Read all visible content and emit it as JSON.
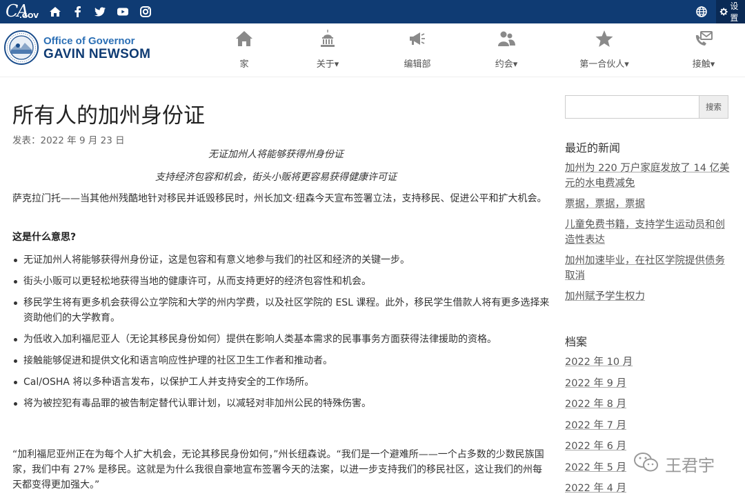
{
  "topbar": {
    "logo_text": "CA",
    "logo_sub": ".GOV",
    "social_icons": [
      "home-icon",
      "facebook-icon",
      "twitter-icon",
      "youtube-icon",
      "instagram-icon"
    ],
    "globe_icon": "globe-icon",
    "settings_label": "设置"
  },
  "header": {
    "brand_line1": "Office of Governor",
    "brand_line2": "GAVIN NEWSOM",
    "nav": [
      {
        "label": "家",
        "icon": "home-icon"
      },
      {
        "label": "关于▾",
        "icon": "capitol-icon"
      },
      {
        "label": "编辑部",
        "icon": "megaphone-icon"
      },
      {
        "label": "约会▾",
        "icon": "people-icon"
      },
      {
        "label": "第一合伙人▾",
        "icon": "star-icon"
      },
      {
        "label": "接触▾",
        "icon": "contact-icon"
      }
    ]
  },
  "article": {
    "title": "所有人的加州身份证",
    "posted": "发表：2022 年 9 月 23 日",
    "sub1": "无证加州人将能够获得州身份证",
    "sub2": "支持经济包容和机会，街头小贩将更容易获得健康许可证",
    "intro": "萨克拉门托——当其他州残酷地针对移民并诋毁移民时，州长加文·纽森今天宣布签署立法，支持移民、促进公平和扩大机会。",
    "heading": "这是什么意思?",
    "bullets": [
      "无证加州人将能够获得州身份证，这是包容和有意义地参与我们的社区和经济的关键一步。",
      "街头小贩可以更轻松地获得当地的健康许可，从而支持更好的经济包容性和机会。",
      "移民学生将有更多机会获得公立学院和大学的州内学费，以及社区学院的 ESL 课程。此外，移民学生借款人将有更多选择来资助他们的大学教育。",
      "为低收入加利福尼亚人（无论其移民身份如何）提供在影响人类基本需求的民事事务方面获得法律援助的资格。",
      "接触能够促进和提供文化和语言响应性护理的社区卫生工作者和推动者。",
      "Cal/OSHA 将以多种语言发布，以保护工人并支持安全的工作场所。",
      "将为被控犯有毒品罪的被告制定替代认罪计划，以减轻对非加州公民的特殊伤害。"
    ],
    "quote": "“加利福尼亚州正在为每个人扩大机会，无论其移民身份如何，”州长纽森说。“我们是一个避难所——一个占多数的少数民族国家，我们中有 27% 是移民。这就是为什么我很自豪地宣布签署今天的法案，以进一步支持我们的移民社区，这让我们的州每天都变得更加强大。”"
  },
  "sidebar": {
    "search_button": "搜索",
    "recent_heading": "最近的新闻",
    "recent": [
      "加州为 220 万户家庭发放了 14 亿美元的水电费减免",
      "票据，票据，票据",
      "儿童免费书籍，支持学生运动员和创造性表达",
      "加州加速毕业，在社区学院提供债务取消",
      "加州赋予学生权力"
    ],
    "archive_heading": "档案",
    "archive": [
      "2022 年 10 月",
      "2022 年 9 月",
      "2022 年 8 月",
      "2022 年 7 月",
      "2022 年 6 月",
      "2022 年 5 月",
      "2022 年 4 月"
    ]
  },
  "watermark": {
    "text": "王君宇",
    "icon": "wechat-icon"
  }
}
